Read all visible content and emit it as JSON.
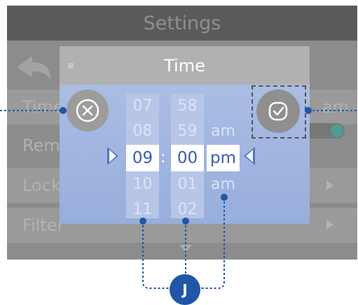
{
  "screen": {
    "title": "Settings",
    "rows": [
      {
        "label": "Time",
        "value": "am"
      },
      {
        "label": "Rem",
        "value": ""
      },
      {
        "label": "Lock",
        "value": ""
      },
      {
        "label": "Filter",
        "value": ""
      }
    ]
  },
  "dialog": {
    "title": "Time",
    "hours": [
      "07",
      "08",
      "09",
      "10",
      "11"
    ],
    "minutes": [
      "58",
      "59",
      "00",
      "01",
      "02"
    ],
    "periods": [
      "am",
      "pm",
      "am"
    ],
    "colon": ":",
    "selected": {
      "hour": "09",
      "minute": "00",
      "period": "pm"
    }
  },
  "callout": {
    "badge_label": "J"
  },
  "colors": {
    "accent": "#1f56a8",
    "selected_text": "#3d5cb2",
    "dialog_bg": "#a4b8e2"
  }
}
